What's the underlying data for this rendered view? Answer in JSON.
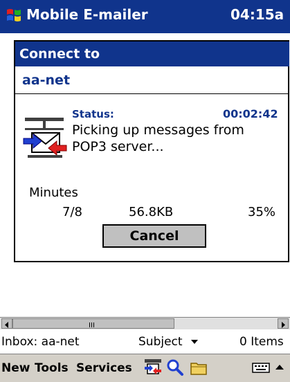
{
  "window": {
    "app_title": "Mobile E-mailer",
    "clock": "04:15a",
    "start_icon": "windows-flag-icon"
  },
  "dialog": {
    "caption": "Connect to",
    "connection_name": "aa-net",
    "status_label": "Status:",
    "elapsed": "00:02:42",
    "status_message": "Picking up messages from POP3 server...",
    "icon": "connection-icon",
    "progress": {
      "label": "Minutes",
      "count": "7/8",
      "bytes": "56.8KB",
      "percent": "35%"
    },
    "cancel_label": "Cancel"
  },
  "list_status": {
    "folder": "Inbox: aa-net",
    "sort": "Subject",
    "items": "0 Items"
  },
  "command_bar": {
    "menus": [
      "New",
      "Tools",
      "Services"
    ],
    "icons": [
      "send-receive-icon",
      "search-icon",
      "folder-icon",
      "keyboard-icon"
    ]
  },
  "colors": {
    "titlebar": "#10348c",
    "accent_text": "#10348c",
    "cmdbar": "#d4d0c8"
  }
}
